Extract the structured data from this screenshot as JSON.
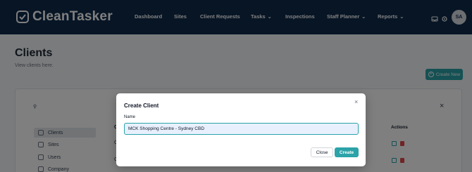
{
  "app": {
    "name": "CleanTasker"
  },
  "nav": {
    "items": [
      {
        "label": "Dashboard",
        "dropdown": false
      },
      {
        "label": "Sites",
        "dropdown": false
      },
      {
        "label": "Client Requests",
        "dropdown": false
      },
      {
        "label": "Tasks",
        "dropdown": true
      },
      {
        "label": "Inspections",
        "dropdown": false
      },
      {
        "label": "Staff Planner",
        "dropdown": true
      },
      {
        "label": "Reports",
        "dropdown": true
      }
    ],
    "icons": [
      "inbox-icon",
      "gear-icon"
    ],
    "avatar_initials": "SA"
  },
  "page": {
    "title": "Clients",
    "subtitle": "View clients here.",
    "create_new_label": "Create New"
  },
  "sidebar": {
    "items": [
      {
        "label": "Clients",
        "active": true
      },
      {
        "label": "Sites",
        "active": false
      },
      {
        "label": "Users",
        "active": false
      },
      {
        "label": "Company",
        "active": false
      }
    ]
  },
  "table": {
    "first_column_letter": "C",
    "actions_header": "Actions",
    "row_letters": [
      "C",
      "C"
    ]
  },
  "modal": {
    "title": "Create Client",
    "name_label": "Name",
    "name_value": "MCK Shopping Centre - Sydney CBD",
    "close_label": "Close",
    "create_label": "Create"
  },
  "colors": {
    "nav_bg": "#0f2a4a",
    "accent": "#2ba3a8",
    "danger": "#e0484b"
  }
}
